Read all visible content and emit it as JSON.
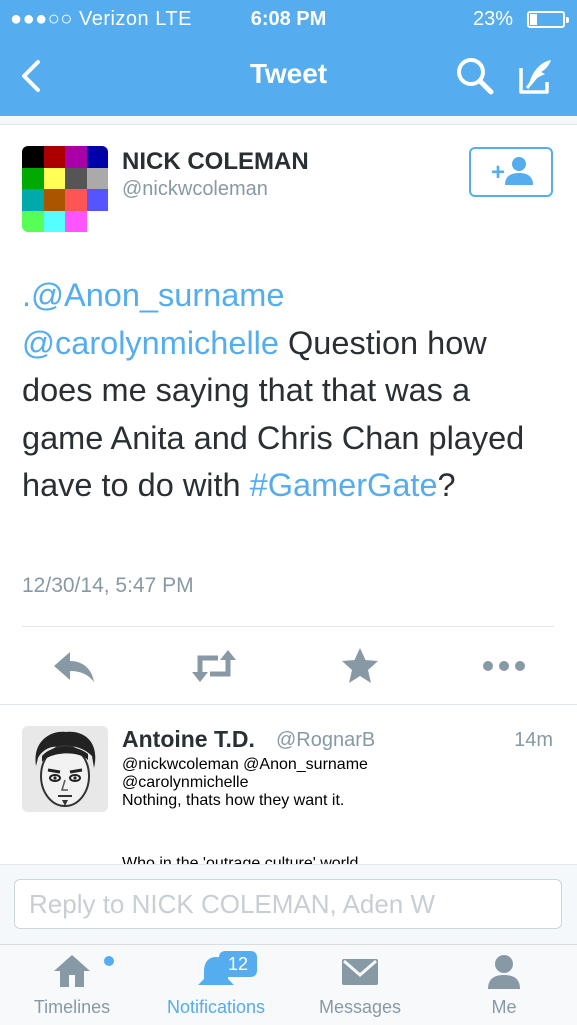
{
  "status_bar": {
    "carrier": "●●●○○ Verizon  LTE",
    "time": "6:08 PM",
    "battery": "23%"
  },
  "nav": {
    "title": "Tweet",
    "icons": [
      "back-chevron-icon",
      "search-icon",
      "compose-icon"
    ]
  },
  "tweet": {
    "author_name": "NICK COLEMAN",
    "author_handle": "@nickwcoleman",
    "body": {
      "mention1": ".@Anon_surname",
      "mention2": "@carolynmichelle",
      "text1": " Question how does me saying that that was a game Anita and Chris Chan played have to do with ",
      "hashtag": "#GamerGate",
      "text2": "?"
    },
    "timestamp": "12/30/14, 5:47 PM",
    "avatar_colors": [
      "#000000",
      "#aa0000",
      "#aa00aa",
      "#0000aa",
      "#00aa00",
      "#ffff55",
      "#555555",
      "#aaaaaa",
      "#00aaaa",
      "#aa5500",
      "#ff5555",
      "#5555ff",
      "#55ff55",
      "#55ffff",
      "#ff55ff",
      "#ffffff"
    ]
  },
  "reply": {
    "name": "Antoine T.D.",
    "handle": "@RognarB",
    "time": "14m",
    "line1": "@nickwcoleman @Anon_surname",
    "line2": "@carolynmichelle",
    "line3": "Nothing, thats how they want it.",
    "line4": "Who in the 'outrage culture' world"
  },
  "reply_bar": {
    "placeholder": "Reply to NICK COLEMAN, Aden W"
  },
  "tabs": [
    {
      "label": "Timelines",
      "icon": "home-icon",
      "active": false
    },
    {
      "label": "Notifications",
      "icon": "bell-icon",
      "active": true,
      "badge": "12"
    },
    {
      "label": "Messages",
      "icon": "envelope-icon",
      "active": false
    },
    {
      "label": "Me",
      "icon": "person-icon",
      "active": false
    }
  ],
  "colors": {
    "accent": "#55acee",
    "text": "#292f33",
    "muted": "#8899a6"
  }
}
